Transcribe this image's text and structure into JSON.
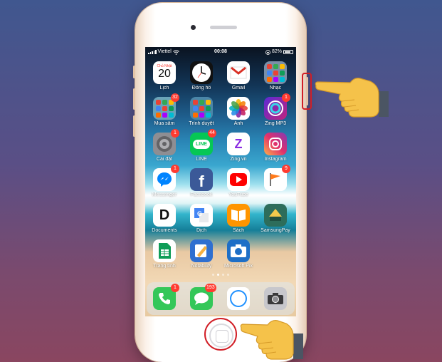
{
  "status_bar": {
    "carrier": "Viettel",
    "time": "00:08",
    "battery": "82%",
    "battery_level": 0.82
  },
  "apps": [
    {
      "name": "app-calendar",
      "label": "Lịch",
      "day": "Chủ Nhật",
      "date": "20",
      "color": "#ffffff"
    },
    {
      "name": "app-clock",
      "label": "Đồng hồ",
      "color": "#111111"
    },
    {
      "name": "app-gmail",
      "label": "Gmail",
      "color": "#ffffff"
    },
    {
      "name": "app-music-folder",
      "label": "Nhạc",
      "color": "#7a8fa8"
    },
    {
      "name": "app-shopping-folder",
      "label": "Mua sắm",
      "badge": "32",
      "color": "#6aa3b8"
    },
    {
      "name": "app-browser-folder",
      "label": "Trình duyệt",
      "color": "#4a86a8"
    },
    {
      "name": "app-photos",
      "label": "Ảnh",
      "color": "#ffffff"
    },
    {
      "name": "app-zing-mp3",
      "label": "Zing MP3",
      "badge": "1",
      "color": "#8b3cc7"
    },
    {
      "name": "app-settings",
      "label": "Cài đặt",
      "badge": "1",
      "color": "#8e8e93"
    },
    {
      "name": "app-line",
      "label": "LINE",
      "badge": "44",
      "glyph": "LINE",
      "color": "#06c755"
    },
    {
      "name": "app-zing-vn",
      "label": "Zing.vn",
      "glyph": "Z",
      "color": "#ffffff"
    },
    {
      "name": "app-instagram",
      "label": "Instagram",
      "color": "#d6249f"
    },
    {
      "name": "app-messenger",
      "label": "Messenger",
      "badge": "1",
      "color": "#ffffff"
    },
    {
      "name": "app-facebook",
      "label": "Facebook",
      "glyph": "f",
      "color": "#3b5998"
    },
    {
      "name": "app-youtube",
      "label": "YouTube",
      "color": "#ffffff"
    },
    {
      "name": "app-flag",
      "label": "",
      "badge": "9",
      "color": "#ffffff"
    },
    {
      "name": "app-documents",
      "label": "Documents",
      "glyph": "D",
      "color": "#ffffff"
    },
    {
      "name": "app-translate",
      "label": "Dịch",
      "color": "#ffffff"
    },
    {
      "name": "app-books",
      "label": "Sách",
      "color": "#ff9500"
    },
    {
      "name": "app-samsung-pay",
      "label": "SamsungPay",
      "color": "#2d6d5b"
    },
    {
      "name": "app-sheets",
      "label": "Trang tính",
      "color": "#ffffff"
    },
    {
      "name": "app-notability",
      "label": "Notability",
      "color": "#2f6fd0"
    },
    {
      "name": "app-microsoft-pix",
      "label": "Microsoft Pix",
      "color": "#1e6fc7"
    }
  ],
  "page_dots": {
    "count": 4,
    "active": 1
  },
  "dock": [
    {
      "name": "dock-phone",
      "badge": "1",
      "color": "#34c759"
    },
    {
      "name": "dock-messages",
      "badge": "193",
      "color": "#34c759"
    },
    {
      "name": "dock-safari",
      "color": "#ffffff"
    },
    {
      "name": "dock-camera",
      "color": "#c7c7cc"
    }
  ],
  "icons": [
    "signal-icon",
    "wifi-icon",
    "lock-rotation-icon",
    "battery-icon",
    "pointing-hand-icon"
  ]
}
